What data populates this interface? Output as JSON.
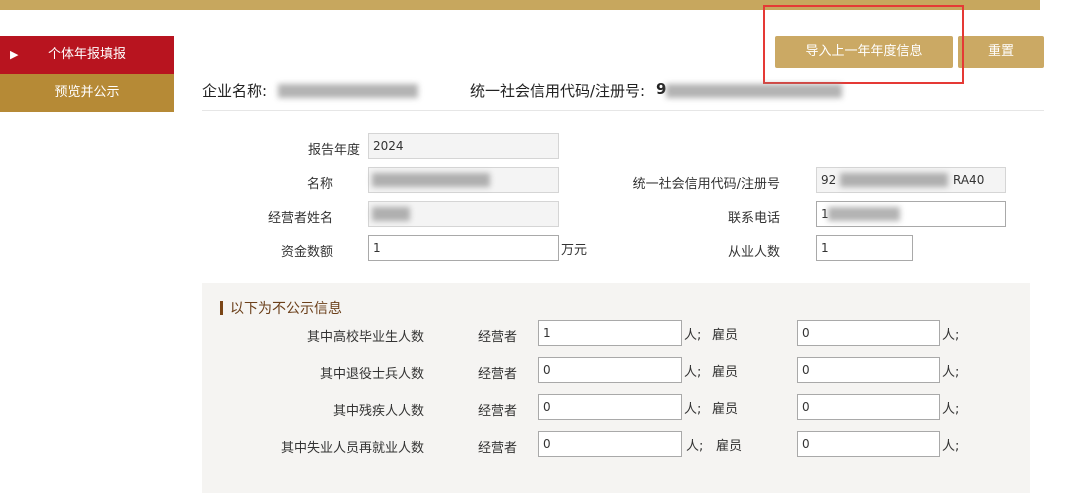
{
  "sidebar": {
    "items": [
      {
        "label": "个体年报填报",
        "active": true
      },
      {
        "label": "预览并公示",
        "active": false
      }
    ]
  },
  "toolbar": {
    "import_label": "导入上一年年度信息",
    "reset_label": "重置"
  },
  "company": {
    "name_label": "企业名称:",
    "code_label": "统一社会信用代码/注册号:",
    "code_prefix": "9"
  },
  "form": {
    "report_year_label": "报告年度",
    "report_year_value": "2024",
    "name_label": "名称",
    "code_label": "统一社会信用代码/注册号",
    "code_prefix": "92",
    "code_suffix": "RA40",
    "operator_label": "经营者姓名",
    "phone_label": "联系电话",
    "phone_prefix": "1",
    "capital_label": "资金数额",
    "capital_value": "1",
    "capital_unit": "万元",
    "employees_label": "从业人数",
    "employees_value": "1"
  },
  "non_public": {
    "title": "以下为不公示信息",
    "operator_label": "经营者",
    "employee_label": "雇员",
    "unit_sep": "人;",
    "unit_end": "人;",
    "rows": [
      {
        "label": "其中高校毕业生人数",
        "operator_value": "1",
        "employee_value": "0"
      },
      {
        "label": "其中退役士兵人数",
        "operator_value": "0",
        "employee_value": "0"
      },
      {
        "label": "其中残疾人人数",
        "operator_value": "0",
        "employee_value": "0"
      },
      {
        "label": "其中失业人员再就业人数",
        "operator_value": "0",
        "employee_value": "0"
      }
    ]
  }
}
